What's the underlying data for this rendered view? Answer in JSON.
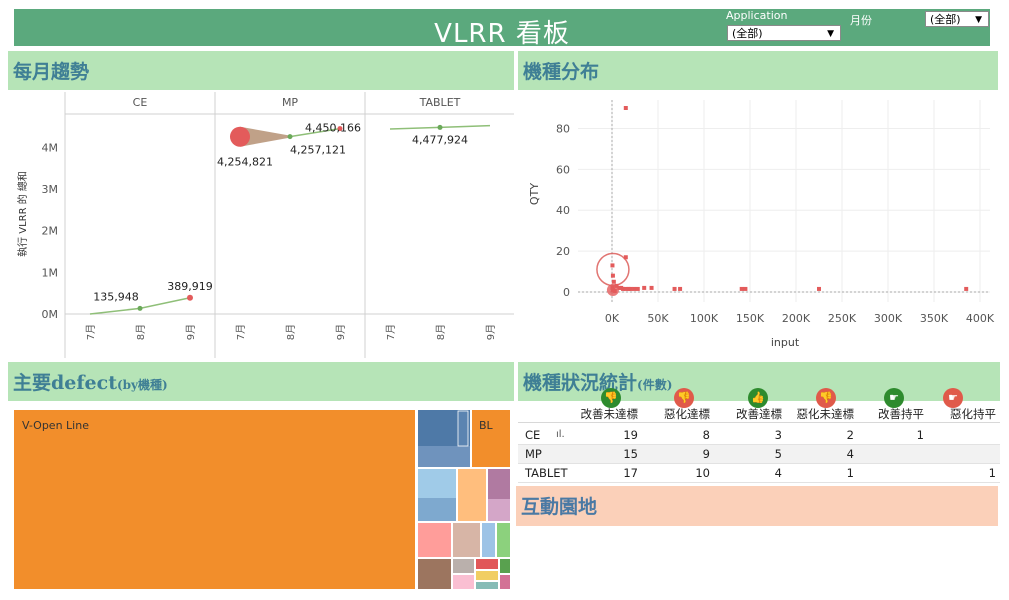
{
  "header": {
    "title": "VLRR 看板",
    "application_label": "Application",
    "application_value": "(全部)",
    "month_label": "月份",
    "month_value": "(全部)"
  },
  "monthly_trend": {
    "section_title": "每月趨勢",
    "panels": [
      "CE",
      "MP",
      "TABLET"
    ],
    "y_axis_label": "執行 VLRR 的 總和",
    "y_ticks": [
      "0M",
      "1M",
      "2M",
      "3M",
      "4M"
    ],
    "x_ticks": [
      "7月",
      "8月",
      "9月"
    ]
  },
  "chart_data": [
    {
      "type": "line",
      "title": "",
      "xlabel": "",
      "ylabel": "執行 VLRR 的 總和",
      "panels": [
        "CE",
        "MP",
        "TABLET"
      ],
      "categories": [
        "7月",
        "8月",
        "9月"
      ],
      "ylim": [
        0,
        4800000
      ],
      "series": [
        {
          "panel": "CE",
          "values": [
            0,
            135948,
            389919
          ],
          "labels": [
            "",
            "135,948",
            "389,919"
          ]
        },
        {
          "panel": "MP",
          "values": [
            4254821,
            4257121,
            4450166
          ],
          "labels": [
            "4,254,821",
            "4,257,121",
            "4,450,166"
          ]
        },
        {
          "panel": "TABLET",
          "values": [
            4440000,
            4477924,
            4520000
          ],
          "labels": [
            "",
            "4,477,924",
            ""
          ]
        }
      ]
    },
    {
      "type": "scatter",
      "title": "",
      "xlabel": "input",
      "ylabel": "QTY",
      "xlim": [
        -30000,
        410000
      ],
      "ylim": [
        -3,
        92
      ],
      "x_ticks": [
        "0K",
        "50K",
        "100K",
        "150K",
        "200K",
        "250K",
        "300K",
        "350K",
        "400K"
      ],
      "y_ticks": [
        "0",
        "20",
        "40",
        "60",
        "80"
      ],
      "x": [
        15000,
        500,
        1000,
        2000,
        5000,
        8000,
        10000,
        12000,
        15000,
        18000,
        20000,
        24000,
        28000,
        35000,
        43000,
        68000,
        74000,
        141000,
        145000,
        225000,
        385000,
        500,
        1000,
        3000,
        15000
      ],
      "y": [
        90,
        13,
        8,
        5,
        3,
        2,
        2,
        1.5,
        1.5,
        1.5,
        1.5,
        1.5,
        1.5,
        2,
        2,
        1.5,
        1.5,
        1.5,
        1.5,
        1.5,
        1.5,
        2,
        1,
        0.5,
        17
      ]
    },
    {
      "type": "treemap",
      "title": "",
      "labels": [
        "V-Open Line",
        "BL"
      ]
    },
    {
      "type": "table",
      "title": "",
      "columns": [
        "改善未達標",
        "惡化達標",
        "改善達標",
        "惡化未達標",
        "改善持平",
        "惡化持平"
      ],
      "rows": [
        {
          "name": "CE",
          "values": [
            "19",
            "8",
            "3",
            "2",
            "1",
            ""
          ]
        },
        {
          "name": "MP",
          "values": [
            "15",
            "9",
            "5",
            "4",
            "",
            ""
          ]
        },
        {
          "name": "TABLET",
          "values": [
            "17",
            "10",
            "4",
            "1",
            "",
            "1"
          ]
        }
      ]
    }
  ],
  "distribution": {
    "section_title": "機種分布"
  },
  "defects": {
    "section_title": "主要defect",
    "section_suffix": "(by機種)",
    "label_main": "V-Open Line",
    "label_bl": "BL"
  },
  "status_stats": {
    "section_title": "機種狀況統計",
    "section_suffix": "(件數)",
    "columns": [
      "改善未達標",
      "惡化達標",
      "改善達標",
      "惡化未達標",
      "改善持平",
      "惡化持平"
    ],
    "icon_colors": [
      "#2e8b2e",
      "#e05a4a",
      "#2e8b2e",
      "#e05a4a",
      "#2e8b2e",
      "#e05a4a"
    ],
    "icon_names": [
      "thumbs-down-icon",
      "thumbs-down-icon",
      "thumbs-up-icon",
      "thumbs-down-icon",
      "pointing-hand-icon",
      "pointing-hand-icon"
    ],
    "rows": [
      {
        "name": "CE",
        "values": [
          "19",
          "8",
          "3",
          "2",
          "1",
          ""
        ]
      },
      {
        "name": "MP",
        "values": [
          "15",
          "9",
          "5",
          "4",
          "",
          ""
        ]
      },
      {
        "name": "TABLET",
        "values": [
          "17",
          "10",
          "4",
          "1",
          "",
          "1"
        ]
      }
    ]
  },
  "interactive": {
    "section_title": "互動園地"
  }
}
